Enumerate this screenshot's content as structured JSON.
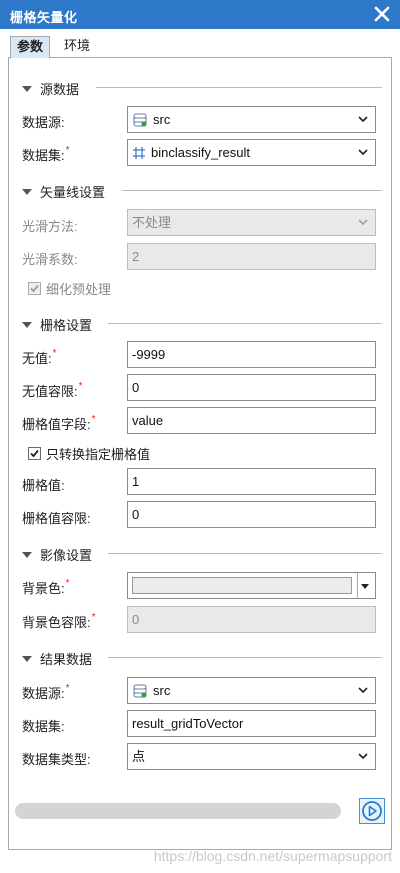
{
  "window": {
    "title": "栅格矢量化",
    "close_icon": "close-icon"
  },
  "tabs": [
    {
      "label": "参数",
      "active": true
    },
    {
      "label": "环境",
      "active": false
    }
  ],
  "source_data": {
    "section_title": "源数据",
    "datasource_label": "数据源:",
    "datasource_value": "src",
    "dataset_label": "数据集:",
    "dataset_value": "binclassify_result"
  },
  "vector_settings": {
    "section_title": "矢量线设置",
    "smooth_method_label": "光滑方法:",
    "smooth_method_value": "不处理",
    "smooth_coef_label": "光滑系数:",
    "smooth_coef_value": "2",
    "thin_label": "细化预处理",
    "thin_checked": true
  },
  "raster_settings": {
    "section_title": "栅格设置",
    "nodata_label": "无值:",
    "nodata_value": "-9999",
    "nodata_tol_label": "无值容限:",
    "nodata_tol_value": "0",
    "field_label": "栅格值字段:",
    "field_value": "value",
    "only_specified_label": "只转换指定栅格值",
    "only_specified_checked": true,
    "value_label": "栅格值:",
    "value_value": "1",
    "value_tol_label": "栅格值容限:",
    "value_tol_value": "0"
  },
  "image_settings": {
    "section_title": "影像设置",
    "bg_color_label": "背景色:",
    "bg_tol_label": "背景色容限:",
    "bg_tol_value": "0"
  },
  "result_data": {
    "section_title": "结果数据",
    "datasource_label": "数据源:",
    "datasource_value": "src",
    "dataset_label": "数据集:",
    "dataset_value": "result_gridToVector",
    "dataset_type_label": "数据集类型:",
    "dataset_type_value": "点"
  },
  "footer": {
    "progress": 0,
    "watermark": "https://blog.csdn.net/supermapsupport"
  },
  "colors": {
    "titlebar": "#2d78c8",
    "required": "#e01e1e",
    "run_button": "#1e7fd8"
  }
}
